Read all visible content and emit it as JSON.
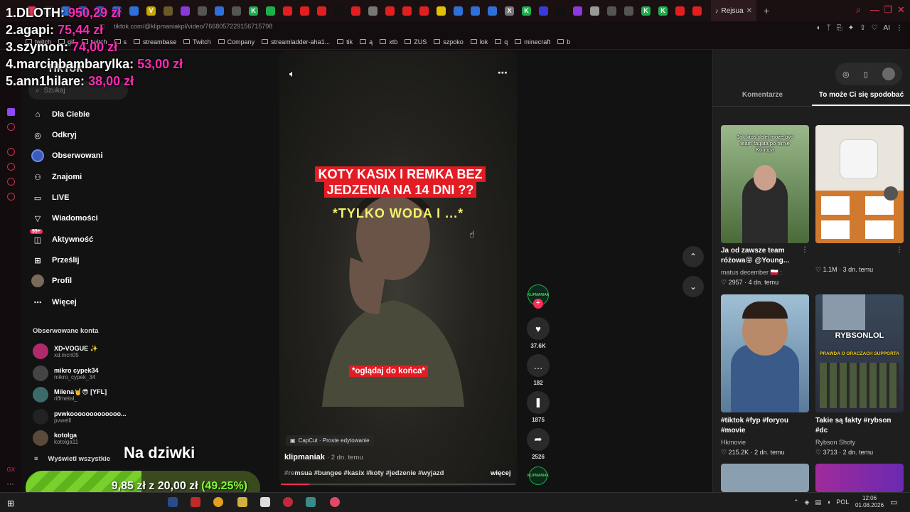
{
  "browser": {
    "active_tab": "Rejsua",
    "url": "tiktok.com/@klipmaniakpl/video/7668057229156715798",
    "tab_icons": [
      {
        "color": "#e03a55",
        "glyph": "",
        "name": "tab-icon-1"
      },
      {
        "color": "#333",
        "glyph": "",
        "name": "tab-icon-2"
      },
      {
        "color": "#2e6fd8",
        "glyph": "",
        "name": "tab-icon-3"
      },
      {
        "color": "#2e6fd8",
        "glyph": "",
        "name": "tab-icon-4"
      },
      {
        "color": "#2e6fd8",
        "glyph": "",
        "name": "tab-icon-5"
      },
      {
        "color": "#2e6fd8",
        "glyph": "",
        "name": "tab-icon-6"
      },
      {
        "color": "#2e6fd8",
        "glyph": "",
        "name": "tab-icon-7"
      },
      {
        "color": "#c9a600",
        "glyph": "V",
        "name": "tab-icon-8"
      },
      {
        "color": "#6a5a2a",
        "glyph": "",
        "name": "tab-icon-9"
      },
      {
        "color": "#8a3ad8",
        "glyph": "",
        "name": "tab-icon-10"
      },
      {
        "color": "#555",
        "glyph": "",
        "name": "tab-icon-11"
      },
      {
        "color": "#2e6fd8",
        "glyph": "",
        "name": "tab-icon-12"
      },
      {
        "color": "#555",
        "glyph": "",
        "name": "tab-icon-13"
      },
      {
        "color": "#1fae4e",
        "glyph": "K",
        "name": "tab-icon-14"
      },
      {
        "color": "#1fae4e",
        "glyph": "",
        "name": "tab-icon-15"
      },
      {
        "color": "#e02020",
        "glyph": "",
        "name": "tab-icon-16"
      },
      {
        "color": "#e02020",
        "glyph": "",
        "name": "tab-icon-17"
      },
      {
        "color": "#e02020",
        "glyph": "",
        "name": "tab-icon-18"
      },
      {
        "color": "#111",
        "glyph": "",
        "name": "tab-icon-19"
      },
      {
        "color": "#e02020",
        "glyph": "",
        "name": "tab-icon-20"
      },
      {
        "color": "#777",
        "glyph": "",
        "name": "tab-icon-21"
      },
      {
        "color": "#e02020",
        "glyph": "",
        "name": "tab-icon-22"
      },
      {
        "color": "#e02020",
        "glyph": "",
        "name": "tab-icon-23"
      },
      {
        "color": "#e02020",
        "glyph": "",
        "name": "tab-icon-24"
      },
      {
        "color": "#e0c000",
        "glyph": "",
        "name": "tab-icon-25"
      },
      {
        "color": "#2e6fd8",
        "glyph": "",
        "name": "tab-icon-26"
      },
      {
        "color": "#2e6fd8",
        "glyph": "",
        "name": "tab-icon-27"
      },
      {
        "color": "#2e6fd8",
        "glyph": "",
        "name": "tab-icon-28"
      },
      {
        "color": "#777",
        "glyph": "X",
        "name": "tab-icon-29"
      },
      {
        "color": "#1fae4e",
        "glyph": "K",
        "name": "tab-icon-30"
      },
      {
        "color": "#3a3ad8",
        "glyph": "",
        "name": "tab-icon-31"
      },
      {
        "color": "#111",
        "glyph": "",
        "name": "tab-icon-32"
      },
      {
        "color": "#8a3ad8",
        "glyph": "",
        "name": "tab-icon-33"
      },
      {
        "color": "#999",
        "glyph": "",
        "name": "tab-icon-34"
      },
      {
        "color": "#555",
        "glyph": "",
        "name": "tab-icon-35"
      },
      {
        "color": "#555",
        "glyph": "",
        "name": "tab-icon-36"
      },
      {
        "color": "#1fae4e",
        "glyph": "K",
        "name": "tab-icon-37"
      },
      {
        "color": "#1fae4e",
        "glyph": "K",
        "name": "tab-icon-38"
      },
      {
        "color": "#e02020",
        "glyph": "",
        "name": "tab-icon-39"
      },
      {
        "color": "#e02020",
        "glyph": "",
        "name": "tab-icon-40"
      }
    ],
    "bookmarks": [
      "twitch",
      "gif",
      "twitch",
      "s",
      "streambase",
      "Twitch",
      "Company",
      "streamladder-aha1...",
      "tik",
      "ą",
      "xtb",
      "ZUS",
      "szpoko",
      "lok",
      "q",
      "minecraft",
      "b"
    ]
  },
  "tiktok": {
    "logo": "TikTok",
    "search_placeholder": "Szukaj",
    "nav": [
      "Dla Ciebie",
      "Odkryj",
      "Obserwowani",
      "Znajomi",
      "LIVE",
      "Wiadomości",
      "Aktywność",
      "Prześlij",
      "Profil",
      "Więcej"
    ],
    "activity_badge": "99+",
    "followed_title": "Obserwowane konta",
    "followed": [
      {
        "name": "XD•VOGUE ✨",
        "handle": "xd.mcn05"
      },
      {
        "name": "mikro cypek34",
        "handle": "mikro_cypek_34"
      },
      {
        "name": "Milena🤘😎 [YFL]",
        "handle": "riffmetal_"
      },
      {
        "name": "pvwkooooooooooooo...",
        "handle": "pvwelll"
      },
      {
        "name": "kotolga",
        "handle": "kotolga11"
      }
    ],
    "show_all": "Wyświetl wszystkie"
  },
  "video": {
    "caption_red": "KOTY KASIX I REMKA BEZ JEDZENIA NA 14 DNI ??",
    "caption_yellow": "*TYLKO WODA I ...*",
    "caption_bottom": "*oglądaj do końca*",
    "capcut": "CapCut · Proste edytowanie",
    "author": "klipmaniak",
    "date": "· 2 dn. temu",
    "tags_prefix": "#re",
    "tags_rest": "msua #bungee #kasix #koty #jedzenie #wyjazd",
    "more": "więcej",
    "likes": "37.6K",
    "comments": "182",
    "saves": "1875",
    "shares": "2526",
    "avatar_label": "KLIPMANIAK",
    "progress": 0.12
  },
  "right_panel": {
    "tabs": [
      "Komentarze",
      "To może Ci się spodobać"
    ],
    "items": [
      {
        "title": "Ja od zawsze team różowa😝 @Young...",
        "author": "matus december 🇵🇱 :",
        "likes": "2957",
        "date": "· 4 dn. temu",
        "overlay": "Jak ktoś dalej może być team fagata po filmie Konopa",
        "c1": "#7aa86a",
        "c2": "#3a5a3a"
      },
      {
        "title": "",
        "author": "",
        "likes": "1.1M",
        "date": "· 3 dn. temu",
        "overlay": "",
        "c1": "#e9e5dc",
        "c2": "#c9602a"
      },
      {
        "title": "#tiktok #fyp #foryou #movie",
        "author": "Hkmovie",
        "likes": "215.2K",
        "date": "· 2 dn. temu",
        "overlay": "",
        "c1": "#8fb4c9",
        "c2": "#2a4a7a"
      },
      {
        "title": "Takie są fakty #rybson #dc",
        "author": "Rybson Shoty",
        "likes": "3713",
        "date": "· 2 dn. temu",
        "overlay": "RYBSONLOL",
        "overlay2": "PRAWDA O GRACZACH SUPPORTA",
        "c1": "#2a3a4a",
        "c2": "#4a2a3a"
      }
    ]
  },
  "overlay": {
    "leaderboard": [
      {
        "rank": "1.",
        "name": "DLOTH:",
        "amount": "950,29 zł"
      },
      {
        "rank": "2.",
        "name": "agapi:",
        "amount": "75,44 zł"
      },
      {
        "rank": "3.",
        "name": "szymon:",
        "amount": "74,00 zł"
      },
      {
        "rank": "4.",
        "name": "marcinbambarylka:",
        "amount": "53,00 zł"
      },
      {
        "rank": "5.",
        "name": "ann1hilare:",
        "amount": "38,00 zł"
      }
    ],
    "goal_title": "Na dziwki",
    "goal_current": "9,85 zł",
    "goal_of": "z",
    "goal_target": "20,00 zł",
    "goal_percent_text": "(49.25%)",
    "goal_fraction": 0.4925
  },
  "taskbar": {
    "lang": "POL",
    "time": "12:06",
    "date": "01.08.2026"
  }
}
